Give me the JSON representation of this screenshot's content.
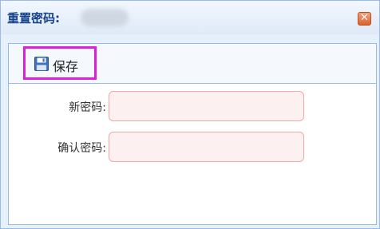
{
  "window": {
    "title": "重置密码:"
  },
  "toolbar": {
    "save_label": "保存",
    "save_icon": "floppy-disk-icon"
  },
  "form": {
    "fields": [
      {
        "label": "新密码:",
        "value": "",
        "placeholder": ""
      },
      {
        "label": "确认密码:",
        "value": "",
        "placeholder": ""
      }
    ]
  },
  "colors": {
    "title_text": "#15428b",
    "border": "#99bbe8",
    "input_background": "#fdf0f0",
    "input_border": "#f0a8a8",
    "highlight": "#e01ee0",
    "close_button": "#d9632f"
  }
}
